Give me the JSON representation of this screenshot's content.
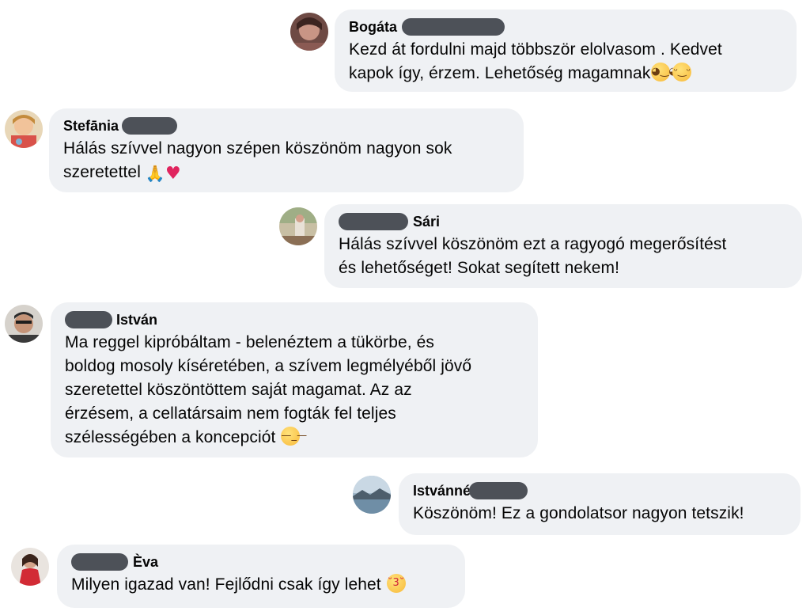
{
  "comments": [
    {
      "name_suffix": "",
      "name_prefix": "Bogáta",
      "lines": [
        "Kezd át fordulni majd többször elolvasom . Kedvet",
        "kapok így, érzem. Lehetőség magamnak"
      ],
      "emojis": [
        "wink-face",
        "relieved-face"
      ]
    },
    {
      "name_prefix": "Stefānia",
      "lines": [
        "Hálás szívvel nagyon szépen köszönöm nagyon sok",
        "szeretettel"
      ],
      "emojis": [
        "folded-hands",
        "red-heart"
      ]
    },
    {
      "name_suffix": "Sári",
      "lines": [
        "Hálás szívvel köszönöm ezt a ragyogó megerősítést",
        "és lehetőséget! Sokat segített nekem!"
      ]
    },
    {
      "name_suffix": "István",
      "lines": [
        "Ma reggel kipróbáltam - belenéztem a tükörbe, és",
        "boldog mosoly kíséretében, a szívem legmélyéből jövő",
        "szeretettel köszöntöttem saját magamat. Az az",
        "érzésem, a cellatársaim nem fogták fel teljes",
        "szélességében a koncepciót"
      ],
      "emojis": [
        "unamused-face"
      ]
    },
    {
      "name_prefix": "Istvánné",
      "lines": [
        "Köszönöm! Ez a gondolatsor nagyon tetszik!"
      ]
    },
    {
      "name_suffix": "Èva",
      "lines": [
        "Milyen igazad van! Fejlődni csak így lehet"
      ],
      "emojis": [
        "kissing-face"
      ]
    }
  ],
  "emoji_glyphs": {
    "folded-hands": "🙏",
    "red-heart": "♥",
    "wink-face": "😏",
    "relieved-face": "☺",
    "unamused-face": "😑",
    "kissing-face": "😘"
  },
  "colors": {
    "bubble": "#eff1f4",
    "text": "#050505",
    "redaction": "#4d5158"
  }
}
